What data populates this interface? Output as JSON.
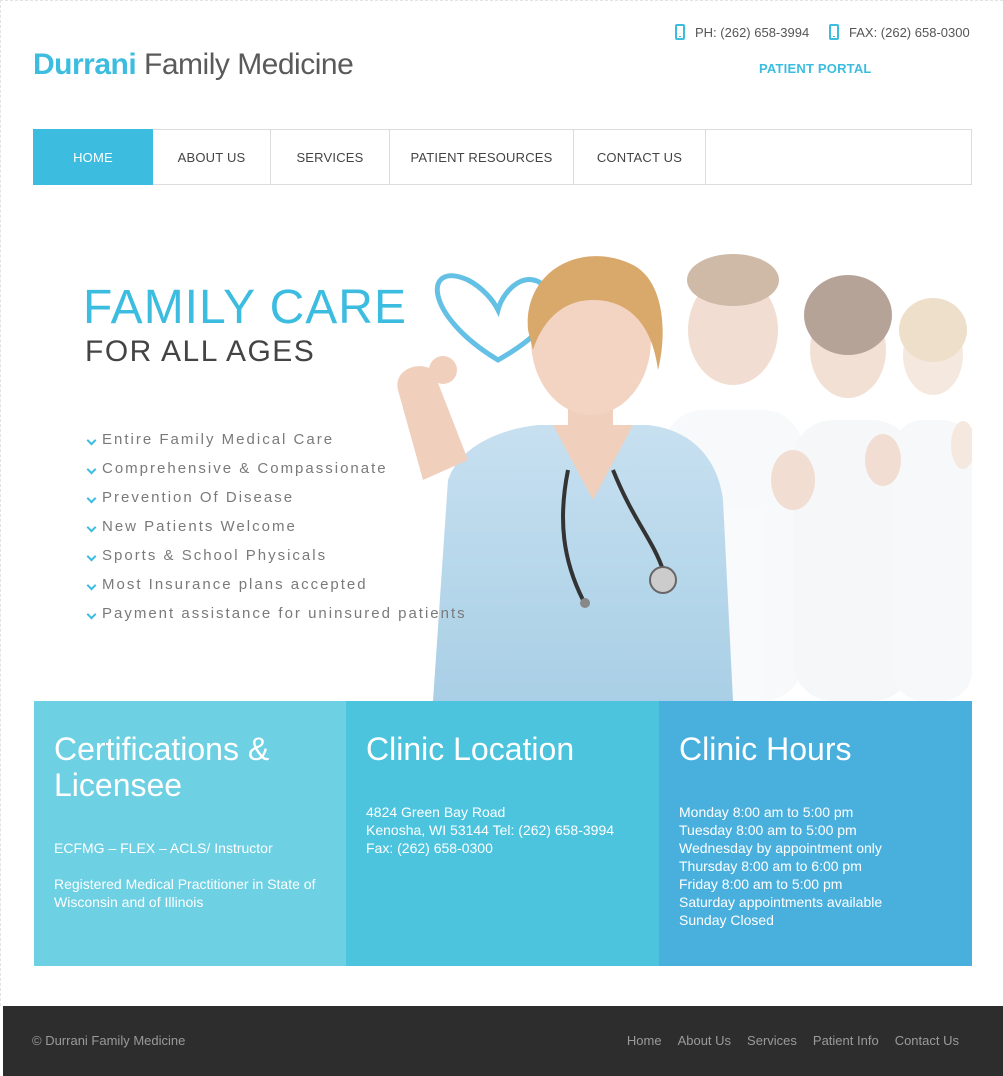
{
  "header": {
    "logo_brand": "Durrani",
    "logo_rest": "Family Medicine",
    "phone": "PH: (262) 658-3994",
    "fax": "FAX: (262) 658-0300",
    "portal": "PATIENT PORTAL"
  },
  "nav": [
    {
      "label": "HOME",
      "active": true
    },
    {
      "label": "ABOUT US"
    },
    {
      "label": "SERVICES"
    },
    {
      "label": "PATIENT RESOURCES"
    },
    {
      "label": "CONTACT US"
    }
  ],
  "hero": {
    "title": "FAMILY CARE",
    "subtitle": "FOR ALL AGES",
    "features": [
      "Entire Family Medical Care",
      "Comprehensive & Compassionate",
      "Prevention Of Disease",
      "New Patients Welcome",
      "Sports & School Physicals",
      "Most Insurance plans accepted",
      "Payment assistance for uninsured patients"
    ]
  },
  "panels": {
    "certifications": {
      "title": "Certifications & Licensee",
      "p1": "ECFMG – FLEX – ACLS/ Instructor",
      "p2": "Registered Medical Practitioner in State of Wisconsin and of Illinois"
    },
    "location": {
      "title": "Clinic Location",
      "lines": [
        "4824 Green Bay Road",
        "Kenosha, WI 53144 Tel: (262) 658-3994",
        "Fax: (262) 658-0300"
      ]
    },
    "hours": {
      "title": "Clinic Hours",
      "lines": [
        "Monday 8:00 am to 5:00 pm",
        "Tuesday 8:00 am to 5:00 pm",
        "Wednesday by appointment only",
        "Thursday 8:00 am to 6:00 pm",
        "Friday 8:00 am to 5:00 pm",
        "Saturday appointments available",
        "Sunday Closed"
      ]
    }
  },
  "footer": {
    "copyright": "© Durrani Family Medicine",
    "links": [
      "Home",
      "About Us",
      "Services",
      "Patient Info",
      "Contact Us"
    ]
  },
  "colors": {
    "accent": "#3cbde0",
    "panel_1": "#6dd0e3",
    "panel_2": "#4cc4de",
    "panel_3": "#49b0de",
    "footer_bg": "#2d2d2d"
  }
}
